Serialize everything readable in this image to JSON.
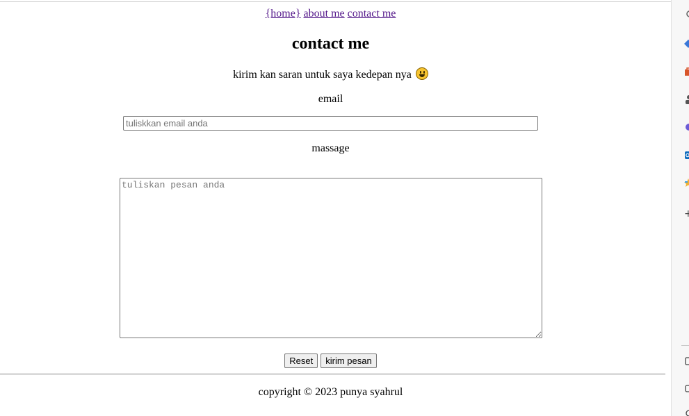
{
  "nav": {
    "home_label": "{home}",
    "about_label": "about me",
    "contact_label": "contact me"
  },
  "page_title": "contact me",
  "subtitle": "kirim kan saran untuk saya kedepan nya",
  "subtitle_icon": "grinning-face-emoji",
  "form": {
    "email_label": "email",
    "email_placeholder": "tuliskkan email anda",
    "email_value": "",
    "message_label": "massage",
    "message_placeholder": "tuliskan pesan anda",
    "message_value": "",
    "reset_label": "Reset",
    "submit_label": "kirim pesan"
  },
  "footer": {
    "copyright": "copyright © 2023 punya syahrul"
  },
  "browser_sidebar": {
    "icons": [
      "search-icon",
      "diamond-icon",
      "shopping-bag-icon",
      "person-icon",
      "copilot-icon",
      "outlook-icon",
      "favorites-icon",
      "add-icon",
      "split-screen-icon",
      "feedback-icon",
      "settings-icon"
    ]
  },
  "colors": {
    "link_visited": "#551a8b",
    "button_bg": "#efefef",
    "border": "#767676"
  }
}
